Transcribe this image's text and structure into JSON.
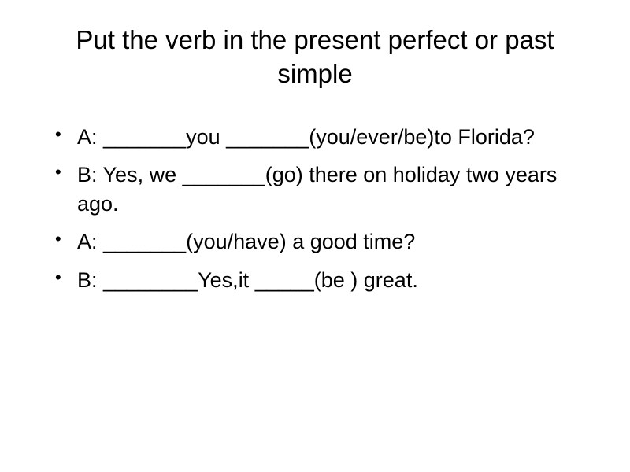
{
  "title": "Put the verb in the present perfect or past simple",
  "items": [
    {
      "text": "A: _______you _______(you/ever/be)to Florida?"
    },
    {
      "text": "B: Yes, we _______(go) there on holiday two years ago."
    },
    {
      "text": "A: _______(you/have) a good time?"
    },
    {
      "text": "B: ________Yes,it _____(be ) great."
    }
  ],
  "bullet": "•"
}
